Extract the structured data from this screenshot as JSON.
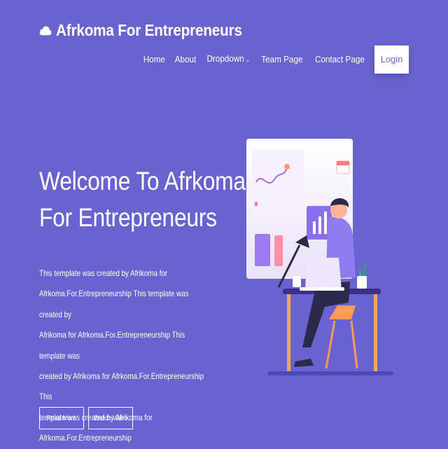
{
  "brand": {
    "name": "Afrkoma For Entrepreneurs",
    "icon": "cloud-icon"
  },
  "nav": {
    "items": [
      "Home",
      "About",
      "Dropdown",
      "Team Page",
      "Contact Page"
    ],
    "login": "Login"
  },
  "hero": {
    "title_line1": "Welcome To Afrkoma",
    "title_line2": "For Entrepreneurs",
    "desc_lines": [
      "This template was created by Afrikoma for",
      "Afrkoma.For.Entrepreneurship This template was created by",
      "Afrikoma for Afrkoma.For.Entrepreneurship This template was",
      "created by Afrikoma for Afrkoma.For.Entrepreneurship This",
      "template was created by Afrikoma for",
      "Afrkoma.For.Entrepreneurship"
    ],
    "buttons": [
      "Read More",
      "Watch Video"
    ]
  },
  "colors": {
    "background": "#6963cf",
    "accent": "#6963cf",
    "text": "#ffffff"
  }
}
